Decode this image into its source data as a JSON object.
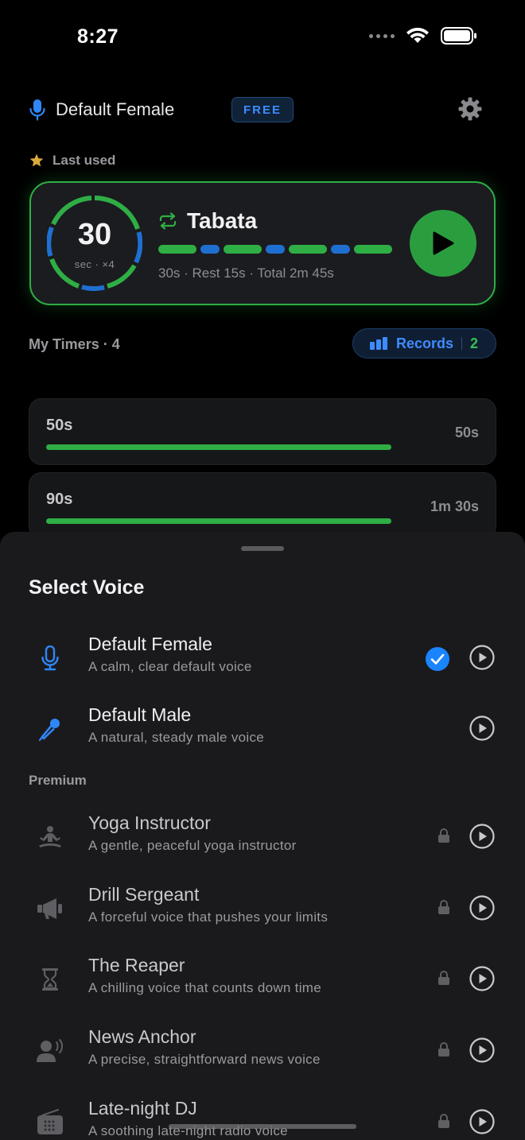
{
  "status": {
    "time": "8:27"
  },
  "header": {
    "voice_name": "Default Female",
    "badge": "FREE"
  },
  "last_used": {
    "label": "Last used"
  },
  "featured": {
    "ring_value": "30",
    "ring_sub": "sec · ×4",
    "title": "Tabata",
    "meta": "30s · Rest 15s · Total 2m 45s"
  },
  "timers": {
    "heading": "My Timers · 4",
    "records_label": "Records",
    "records_count": "2",
    "items": [
      {
        "name": "50s",
        "duration": "50s"
      },
      {
        "name": "90s",
        "duration": "1m 30s"
      }
    ]
  },
  "sheet": {
    "title": "Select Voice",
    "premium_label": "Premium",
    "voices": [
      {
        "name": "Default Female",
        "desc": "A calm, clear default voice",
        "icon": "microphone-icon"
      },
      {
        "name": "Default Male",
        "desc": "A natural, steady male voice",
        "icon": "handheld-mic-icon"
      },
      {
        "name": "Yoga Instructor",
        "desc": "A gentle, peaceful yoga instructor",
        "icon": "meditation-icon"
      },
      {
        "name": "Drill Sergeant",
        "desc": "A forceful voice that pushes your limits",
        "icon": "megaphone-icon"
      },
      {
        "name": "The Reaper",
        "desc": "A chilling voice that counts down time",
        "icon": "hourglass-icon"
      },
      {
        "name": "News Anchor",
        "desc": "A precise, straightforward news voice",
        "icon": "speaking-person-icon"
      },
      {
        "name": "Late-night DJ",
        "desc": "A soothing late-night radio voice",
        "icon": "radio-icon"
      }
    ]
  },
  "colors": {
    "accent_green": "#2fae45",
    "accent_blue": "#1f6fd1",
    "link_blue": "#3d8cff"
  }
}
